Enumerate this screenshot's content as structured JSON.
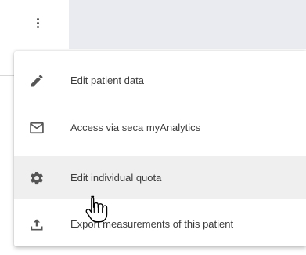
{
  "toolbar": {
    "more_icon": "more-vertical-icon"
  },
  "menu": {
    "items": [
      {
        "label": "Edit patient data",
        "icon": "pencil-icon"
      },
      {
        "label": "Access via seca myAnalytics",
        "icon": "mail-icon"
      },
      {
        "label": "Edit individual quota",
        "icon": "gear-icon",
        "hovered": true
      },
      {
        "label": "Export measurements of this patient",
        "icon": "upload-icon"
      }
    ]
  },
  "cursor": {
    "icon": "hand-pointer-icon"
  },
  "colors": {
    "icon": "#555555",
    "text": "#3c3c3c",
    "hover_bg": "#efefef",
    "header_bg": "#e9ebf0"
  }
}
